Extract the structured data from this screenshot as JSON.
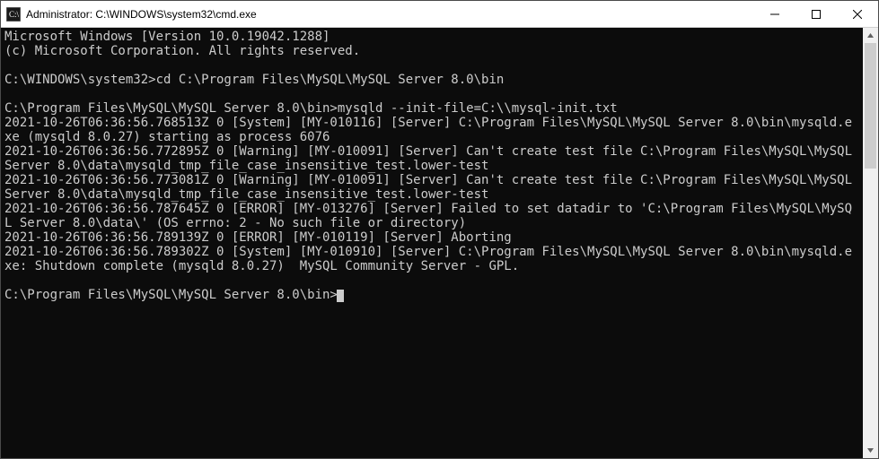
{
  "titlebar": {
    "title": "Administrator: C:\\WINDOWS\\system32\\cmd.exe"
  },
  "terminal": {
    "lines": "Microsoft Windows [Version 10.0.19042.1288]\n(c) Microsoft Corporation. All rights reserved.\n\nC:\\WINDOWS\\system32>cd C:\\Program Files\\MySQL\\MySQL Server 8.0\\bin\n\nC:\\Program Files\\MySQL\\MySQL Server 8.0\\bin>mysqld --init-file=C:\\\\mysql-init.txt\n2021-10-26T06:36:56.768513Z 0 [System] [MY-010116] [Server] C:\\Program Files\\MySQL\\MySQL Server 8.0\\bin\\mysqld.exe (mysqld 8.0.27) starting as process 6076\n2021-10-26T06:36:56.772895Z 0 [Warning] [MY-010091] [Server] Can't create test file C:\\Program Files\\MySQL\\MySQL Server 8.0\\data\\mysqld_tmp_file_case_insensitive_test.lower-test\n2021-10-26T06:36:56.773081Z 0 [Warning] [MY-010091] [Server] Can't create test file C:\\Program Files\\MySQL\\MySQL Server 8.0\\data\\mysqld_tmp_file_case_insensitive_test.lower-test\n2021-10-26T06:36:56.787645Z 0 [ERROR] [MY-013276] [Server] Failed to set datadir to 'C:\\Program Files\\MySQL\\MySQL Server 8.0\\data\\' (OS errno: 2 - No such file or directory)\n2021-10-26T06:36:56.789139Z 0 [ERROR] [MY-010119] [Server] Aborting\n2021-10-26T06:36:56.789302Z 0 [System] [MY-010910] [Server] C:\\Program Files\\MySQL\\MySQL Server 8.0\\bin\\mysqld.exe: Shutdown complete (mysqld 8.0.27)  MySQL Community Server - GPL.\n\nC:\\Program Files\\MySQL\\MySQL Server 8.0\\bin>"
  }
}
